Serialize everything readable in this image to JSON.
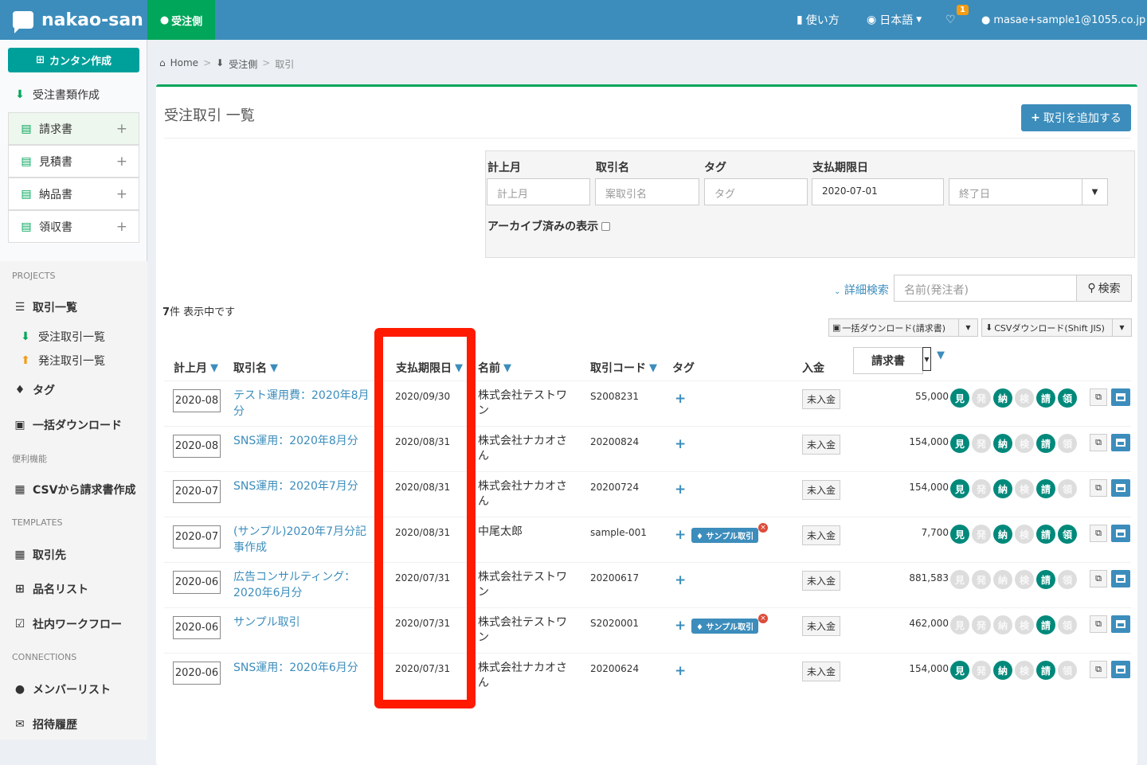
{
  "header": {
    "brand": "nakao-san",
    "active_tab": "受注側",
    "help": "使い方",
    "language": "日本語",
    "notif_count": "1",
    "user": "masae+sample1@1055.co.jp"
  },
  "sidebar": {
    "quick_create": "カンタン作成",
    "order_docs": "受注書類作成",
    "docs": [
      {
        "label": "請求書"
      },
      {
        "label": "見積書"
      },
      {
        "label": "納品書"
      },
      {
        "label": "領収書"
      }
    ],
    "projects_head": "PROJECTS",
    "deals": "取引一覧",
    "received_deals": "受注取引一覧",
    "placed_deals": "発注取引一覧",
    "tags": "タグ",
    "bulk_download": "一括ダウンロード",
    "utility_head": "便利機能",
    "csv_invoice": "CSVから請求書作成",
    "templates_head": "TEMPLATES",
    "clients": "取引先",
    "items": "品名リスト",
    "workflow": "社内ワークフロー",
    "connections_head": "CONNECTIONS",
    "members": "メンバーリスト",
    "invites": "招待履歴"
  },
  "breadcrumb": {
    "home": "Home",
    "section": "受注側",
    "page": "取引"
  },
  "main": {
    "title": "受注取引 一覧",
    "add_button": "取引を追加する"
  },
  "filters": {
    "month_label": "計上月",
    "month_placeholder": "計上月",
    "deal_label": "取引名",
    "deal_placeholder": "案取引名",
    "tag_label": "タグ",
    "tag_placeholder": "タグ",
    "due_label": "支払期限日",
    "due_start": "2020-07-01",
    "due_end_placeholder": "終了日",
    "archive_label": "アーカイブ済みの表示"
  },
  "search": {
    "advanced": "詳細検索",
    "placeholder": "名前(発注者)",
    "button": "検索"
  },
  "list": {
    "count": "7",
    "count_suffix": "件 表示中です",
    "bulk_dl": "一括ダウンロード(請求書)",
    "csv_dl": "CSVダウンロード(Shift JIS)"
  },
  "columns": {
    "month": "計上月",
    "deal": "取引名",
    "due": "支払期限日",
    "client": "名前",
    "code": "取引コード",
    "tag": "タグ",
    "payment": "入金",
    "doc_select": "請求書"
  },
  "doc_labels": [
    "見",
    "発",
    "納",
    "検",
    "請",
    "領"
  ],
  "rows": [
    {
      "month": "2020-08",
      "name": "テスト運用費：2020年8月分",
      "due": "2020/09/30",
      "client": "株式会社テストワン",
      "code": "S2008231",
      "tag": "",
      "status": "未入金",
      "amount": "55,000",
      "docs": [
        1,
        0,
        1,
        0,
        1,
        1
      ]
    },
    {
      "month": "2020-08",
      "name": "SNS運用：2020年8月分",
      "due": "2020/08/31",
      "client": "株式会社ナカオさん",
      "code": "20200824",
      "tag": "",
      "status": "未入金",
      "amount": "154,000",
      "docs": [
        1,
        0,
        1,
        0,
        1,
        0
      ]
    },
    {
      "month": "2020-07",
      "name": "SNS運用：2020年7月分",
      "due": "2020/08/31",
      "client": "株式会社ナカオさん",
      "code": "20200724",
      "tag": "",
      "status": "未入金",
      "amount": "154,000",
      "docs": [
        1,
        0,
        1,
        0,
        1,
        0
      ]
    },
    {
      "month": "2020-07",
      "name": "(サンプル)2020年7月分記事作成",
      "due": "2020/08/31",
      "client": "中尾太郎",
      "code": "sample-001",
      "tag": "サンプル取引",
      "status": "未入金",
      "amount": "7,700",
      "docs": [
        1,
        0,
        1,
        0,
        1,
        1
      ]
    },
    {
      "month": "2020-06",
      "name": "広告コンサルティング：2020年6月分",
      "due": "2020/07/31",
      "client": "株式会社テストワン",
      "code": "20200617",
      "tag": "",
      "status": "未入金",
      "amount": "881,583",
      "docs": [
        0,
        0,
        0,
        0,
        1,
        0
      ]
    },
    {
      "month": "2020-06",
      "name": "サンプル取引",
      "due": "2020/07/31",
      "client": "株式会社テストワン",
      "code": "S2020001",
      "tag": "サンプル取引",
      "status": "未入金",
      "amount": "462,000",
      "docs": [
        0,
        0,
        0,
        0,
        1,
        0
      ]
    },
    {
      "month": "2020-06",
      "name": "SNS運用：2020年6月分",
      "due": "2020/07/31",
      "client": "株式会社ナカオさん",
      "code": "20200624",
      "tag": "",
      "status": "未入金",
      "amount": "154,000",
      "docs": [
        1,
        0,
        1,
        0,
        1,
        0
      ]
    }
  ],
  "colors": {
    "primary": "#3c8dbc",
    "success": "#00a65a",
    "highlight": "#ff1a00"
  }
}
